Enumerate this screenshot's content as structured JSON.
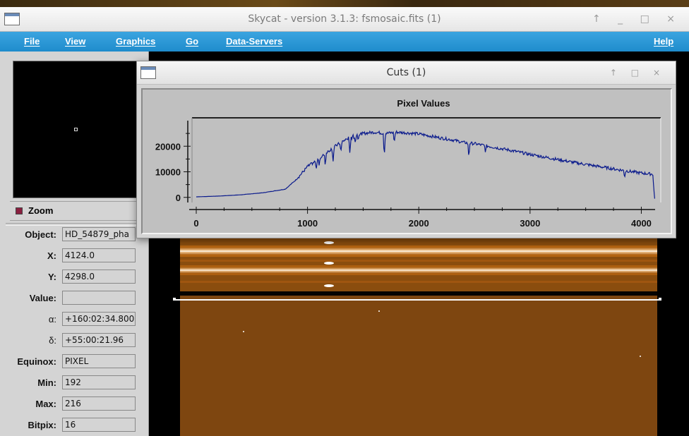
{
  "main_window": {
    "title": "Skycat - version 3.1.3: fsmosaic.fits (1)",
    "controls": "↑ _ □ ×"
  },
  "menu": {
    "file": "File",
    "view": "View",
    "graphics": "Graphics",
    "go": "Go",
    "data_servers": "Data-Servers",
    "help": "Help"
  },
  "zoom": {
    "label": "Zoom"
  },
  "info_fields": [
    {
      "label": "Object:",
      "value": "HD_54879_pha"
    },
    {
      "label": "X:",
      "value": "4124.0"
    },
    {
      "label": "Y:",
      "value": "4298.0"
    },
    {
      "label": "Value:",
      "value": ""
    },
    {
      "label": "α:",
      "value": "+160:02:34.800"
    },
    {
      "label": "δ:",
      "value": "+55:00:21.96"
    },
    {
      "label": "Equinox:",
      "value": "PIXEL"
    },
    {
      "label": "Min:",
      "value": "192"
    },
    {
      "label": "Max:",
      "value": "216"
    },
    {
      "label": "Bitpix:",
      "value": "16"
    }
  ],
  "cuts_window": {
    "title": "Cuts (1)",
    "controls": "↑ □ ×"
  },
  "colors": {
    "menubar": "#1f8ccc",
    "plot_line": "#0a1a8c",
    "plot_bg": "#c0c0c0"
  },
  "chart_data": {
    "type": "line",
    "title": "Pixel Values",
    "xlim": [
      0,
      4124
    ],
    "ylim": [
      -2000,
      30000
    ],
    "xticks": [
      0,
      1000,
      2000,
      3000,
      4000
    ],
    "yticks": [
      0,
      10000,
      20000
    ],
    "xtick_labels": [
      "0",
      "1000",
      "2000",
      "3000",
      "4000"
    ],
    "ytick_labels": [
      "0",
      "10000",
      "20000"
    ],
    "series": [
      {
        "x": [
          0,
          200,
          400,
          600,
          800,
          900,
          1000,
          1100,
          1200,
          1300,
          1400,
          1500,
          1600,
          1700,
          1800,
          1900,
          2000,
          2100,
          2200,
          2300,
          2400,
          2500,
          2600,
          2700,
          2800,
          2900,
          3000,
          3200,
          3400,
          3600,
          3800,
          4000,
          4120
        ],
        "y": [
          200,
          500,
          1000,
          1800,
          3200,
          7000,
          12000,
          15000,
          18500,
          21500,
          24000,
          25000,
          25500,
          25000,
          25500,
          25200,
          24800,
          24000,
          23200,
          22500,
          21500,
          21000,
          20200,
          19400,
          18600,
          17700,
          16800,
          15200,
          13600,
          12200,
          10800,
          9500,
          9000
        ]
      }
    ],
    "dips": [
      {
        "x": 1080,
        "depth": 3000
      },
      {
        "x": 1160,
        "depth": 4500
      },
      {
        "x": 1230,
        "depth": 5000
      },
      {
        "x": 1300,
        "depth": 4000
      },
      {
        "x": 1380,
        "depth": 6500
      },
      {
        "x": 1430,
        "depth": 3000
      },
      {
        "x": 1690,
        "depth": 9000
      },
      {
        "x": 1780,
        "depth": 4000
      },
      {
        "x": 2450,
        "depth": 5500
      },
      {
        "x": 2600,
        "depth": 2500
      },
      {
        "x": 3850,
        "depth": 2500
      },
      {
        "x": 4115,
        "depth": 8500
      }
    ]
  }
}
